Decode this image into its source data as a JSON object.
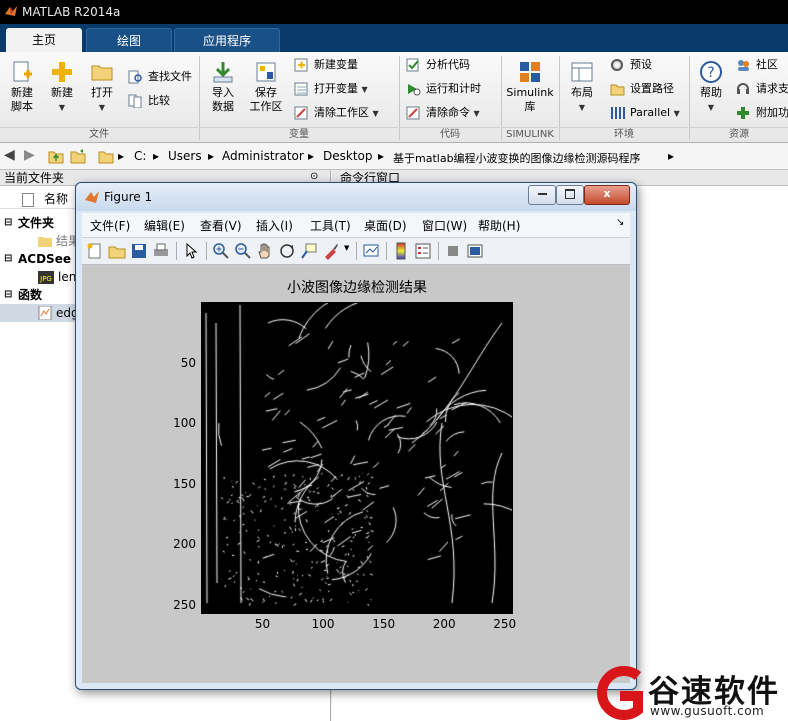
{
  "app": {
    "title": "MATLAB R2014a"
  },
  "tabs": [
    {
      "label": "主页",
      "active": true
    },
    {
      "label": "绘图",
      "active": false
    },
    {
      "label": "应用程序",
      "active": false
    }
  ],
  "ribbon": {
    "file": {
      "new_script": "新建\n脚本",
      "new_script_l1": "新建",
      "new_script_l2": "脚本",
      "new": "新建",
      "open": "打开",
      "find_files": "查找文件",
      "compare": "比较",
      "group": "文件"
    },
    "variable": {
      "import_l1": "导入",
      "import_l2": "数据",
      "save_l1": "保存",
      "save_l2": "工作区",
      "new_var": "新建变量",
      "open_var": "打开变量",
      "clear_ws": "清除工作区",
      "group": "变量"
    },
    "code": {
      "analyze": "分析代码",
      "run_time": "运行和计时",
      "clear_cmd": "清除命令",
      "group": "代码"
    },
    "simulink": {
      "l1": "Simulink",
      "l2": "库",
      "group": "SIMULINK"
    },
    "env": {
      "layout": "布局",
      "prefs": "预设",
      "set_path": "设置路径",
      "parallel": "Parallel",
      "group": "环境"
    },
    "resources": {
      "help": "帮助",
      "community": "社区",
      "request_support": "请求支",
      "addons": "附加功",
      "group": "资源"
    }
  },
  "address": {
    "crumbs": [
      "C:",
      "Users",
      "Administrator",
      "Desktop",
      "基于matlab编程小波变换的图像边缘检测源码程序"
    ]
  },
  "left_panel": {
    "header": "当前文件夹",
    "col_name": "名称",
    "rows": [
      {
        "label": "文件夹",
        "bold": true
      },
      {
        "label": "结果",
        "bold": false
      },
      {
        "label": "ACDSee ...",
        "bold": true
      },
      {
        "label": "len",
        "bold": false
      },
      {
        "label": "函数",
        "bold": true
      },
      {
        "label": "edg",
        "bold": false
      }
    ]
  },
  "command_window": {
    "header": "命令行窗口"
  },
  "figure": {
    "title": "Figure 1",
    "menu": [
      "文件(F)",
      "编辑(E)",
      "查看(V)",
      "插入(I)",
      "工具(T)",
      "桌面(D)",
      "窗口(W)",
      "帮助(H)"
    ],
    "menu_arrow": "↘",
    "close_glyph": "x",
    "plot_title": "小波图像边缘检测结果",
    "y_ticks": [
      "50",
      "100",
      "150",
      "200",
      "250"
    ],
    "x_ticks": [
      "50",
      "100",
      "150",
      "200",
      "250"
    ]
  },
  "watermark": {
    "brand": "谷速软件",
    "url": "www.gusuoft.com"
  },
  "colors": {
    "tab_strip": "#0a3a6a",
    "title_bar": "#000000",
    "figure_bg": "#c8c8c8",
    "axes_bg": "#000000",
    "watermark_red": "#d8161a"
  }
}
